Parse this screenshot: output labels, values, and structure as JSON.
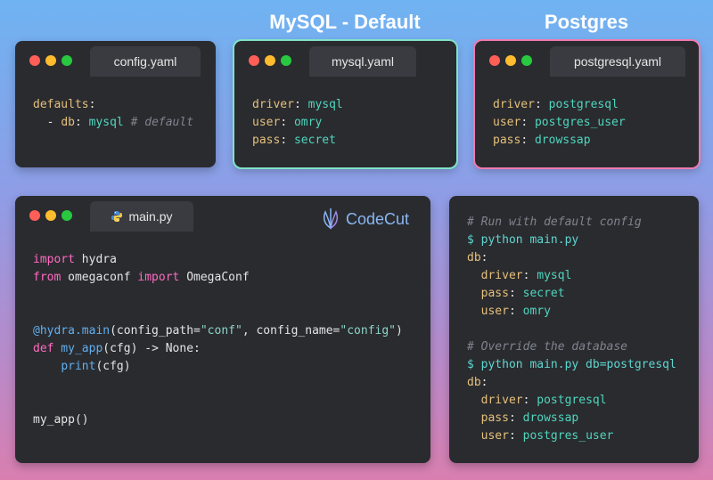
{
  "headings": {
    "mysql": "MySQL - Default",
    "postgres": "Postgres"
  },
  "config_window": {
    "tab": "config.yaml",
    "lines": {
      "l1_key": "defaults",
      "l2_dash": "- ",
      "l2_key": "db",
      "l2_val": "mysql",
      "l2_comment": "# default"
    }
  },
  "mysql_window": {
    "tab": "mysql.yaml",
    "driver_key": "driver",
    "driver_val": "mysql",
    "user_key": "user",
    "user_val": "omry",
    "pass_key": "pass",
    "pass_val": "secret"
  },
  "postgres_window": {
    "tab": "postgresql.yaml",
    "driver_key": "driver",
    "driver_val": "postgresql",
    "user_key": "user",
    "user_val": "postgres_user",
    "pass_key": "pass",
    "pass_val": "drowssap"
  },
  "main_window": {
    "tab": "main.py",
    "logo": "CodeCut",
    "code": {
      "kw_import": "import",
      "mod_hydra": " hydra",
      "kw_from": "from",
      "mod_omegaconf": " omegaconf ",
      "kw_import2": "import",
      "cls_omegaconf": " OmegaConf",
      "decorator": "@hydra.main",
      "paren_open": "(",
      "arg1": "config_path=",
      "str1": "\"conf\"",
      "comma": ", ",
      "arg2": "config_name=",
      "str2": "\"config\"",
      "paren_close": ")",
      "kw_def": "def",
      "fn_name": " my_app",
      "sig": "(cfg) -> None:",
      "indent": "    ",
      "print_fn": "print",
      "print_args": "(cfg)",
      "call": "my_app()"
    }
  },
  "terminal_window": {
    "comment1": "# Run with default config",
    "cmd1": "$ python main.py",
    "db1": "db",
    "out1": {
      "driver_key": "driver",
      "driver_val": "mysql",
      "pass_key": "pass",
      "pass_val": "secret",
      "user_key": "user",
      "user_val": "omry"
    },
    "comment2": "# Override the database",
    "cmd2": "$ python main.py db=postgresql",
    "db2": "db",
    "out2": {
      "driver_key": "driver",
      "driver_val": "postgresql",
      "pass_key": "pass",
      "pass_val": "drowssap",
      "user_key": "user",
      "user_val": "postgres_user"
    }
  },
  "colors": {
    "mysql_border": "#7fe3c8",
    "postgres_border": "#f07bb0",
    "window_bg": "#2a2b2f"
  }
}
